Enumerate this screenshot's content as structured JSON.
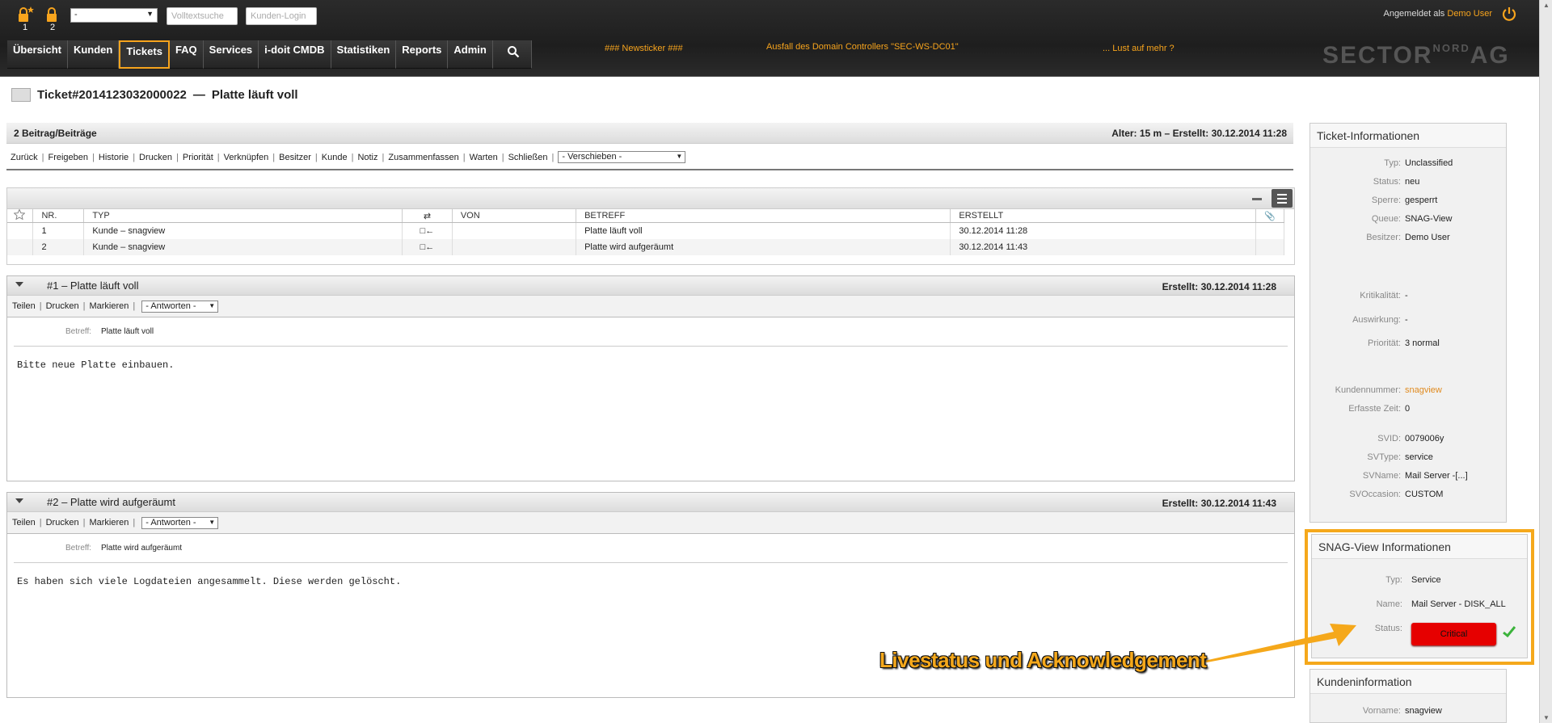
{
  "header": {
    "locks": [
      {
        "icon": "lock-star-icon",
        "count": "1"
      },
      {
        "icon": "lock-icon",
        "count": "2"
      }
    ],
    "queue_select": "-",
    "fulltext_placeholder": "Volltextsuche",
    "customer_login_placeholder": "Kunden-Login",
    "logged_in_label": "Angemeldet als",
    "user": "Demo User",
    "nav": [
      "Übersicht",
      "Kunden",
      "Tickets",
      "FAQ",
      "Services",
      "i-doit CMDB",
      "Statistiken",
      "Reports",
      "Admin"
    ],
    "active_nav": "Tickets",
    "ticker": [
      "### Newsticker ###",
      "Ausfall des Domain Controllers \"SEC-WS-DC01\"",
      "... Lust auf mehr ?"
    ],
    "logo_main": "SECTOR",
    "logo_sup": "NORD",
    "logo_end": "AG",
    "accent": "#f7a41d"
  },
  "ticket": {
    "number": "Ticket#2014123032000022",
    "dash": "—",
    "title": "Platte läuft voll",
    "articles_count": "2 Beitrag/Beiträge",
    "age": "Alter: 15 m – Erstellt: 30.12.2014 11:28",
    "actions": [
      "Zurück",
      "Freigeben",
      "Historie",
      "Drucken",
      "Priorität",
      "Verknüpfen",
      "Besitzer",
      "Kunde",
      "Notiz",
      "Zusammenfassen",
      "Warten",
      "Schließen"
    ],
    "move_select": "- Verschieben -"
  },
  "article_table": {
    "columns": {
      "nr": "NR.",
      "typ": "TYP",
      "von": "VON",
      "betreff": "BETREFF",
      "erstellt": "ERSTELLT"
    },
    "rows": [
      {
        "nr": "1",
        "typ": "Kunde – snagview",
        "dir": "□←",
        "von": "",
        "betreff": "Platte läuft voll",
        "erstellt": "30.12.2014 11:28"
      },
      {
        "nr": "2",
        "typ": "Kunde – snagview",
        "dir": "□←",
        "von": "",
        "betreff": "Platte wird aufgeräumt",
        "erstellt": "30.12.2014 11:43"
      }
    ]
  },
  "articles": [
    {
      "title": "#1 – Platte läuft voll",
      "created": "Erstellt: 30.12.2014 11:28",
      "actions": [
        "Teilen",
        "Drucken",
        "Markieren"
      ],
      "reply_select": "- Antworten -",
      "subject_label": "Betreff:",
      "subject": "Platte läuft voll",
      "body": "Bitte neue Platte einbauen."
    },
    {
      "title": "#2 – Platte wird aufgeräumt",
      "created": "Erstellt: 30.12.2014 11:43",
      "actions": [
        "Teilen",
        "Drucken",
        "Markieren"
      ],
      "reply_select": "- Antworten -",
      "subject_label": "Betreff:",
      "subject": "Platte wird aufgeräumt",
      "body": "Es haben sich viele Logdateien angesammelt. Diese werden gelöscht."
    }
  ],
  "ticket_info": {
    "title": "Ticket-Informationen",
    "rows": [
      {
        "k": "Typ:",
        "v": "Unclassified"
      },
      {
        "k": "Status:",
        "v": "neu"
      },
      {
        "k": "Sperre:",
        "v": "gesperrt"
      },
      {
        "k": "Queue:",
        "v": "SNAG-View"
      },
      {
        "k": "Besitzer:",
        "v": "Demo User"
      },
      {
        "k": "Kritikalität:",
        "v": "-"
      },
      {
        "k": "Auswirkung:",
        "v": "-"
      },
      {
        "k": "Priorität:",
        "v": "3 normal"
      },
      {
        "k": "Kundennummer:",
        "v": "snagview"
      },
      {
        "k": "Erfasste Zeit:",
        "v": "0"
      },
      {
        "k": "SVID:",
        "v": "0079006y"
      },
      {
        "k": "SVType:",
        "v": "service"
      },
      {
        "k": "SVName:",
        "v": "Mail Server -[...]"
      },
      {
        "k": "SVOccasion:",
        "v": "CUSTOM"
      }
    ]
  },
  "snag_info": {
    "title": "SNAG-View Informationen",
    "typ_label": "Typ:",
    "typ": "Service",
    "name_label": "Name:",
    "name": "Mail Server - DISK_ALL",
    "status_label": "Status:",
    "status": "Critical",
    "status_color": "#e60000",
    "highlight_color": "#f5a81b"
  },
  "callout": "Livestatus und Acknowledgement",
  "customer_info": {
    "title": "Kundeninformation",
    "vorname_label": "Vorname:",
    "vorname": "snagview"
  }
}
